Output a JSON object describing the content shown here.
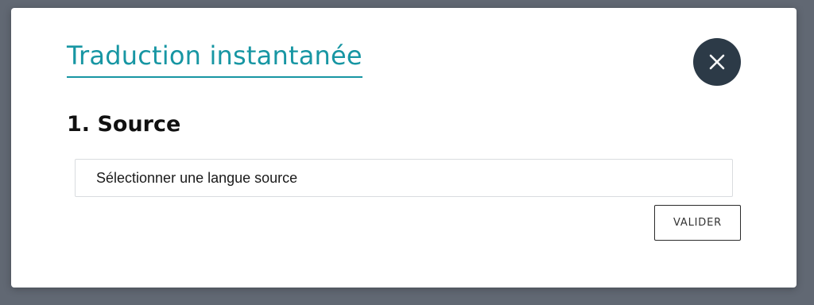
{
  "modal": {
    "title": "Traduction instantanée",
    "close_icon": "close-icon",
    "section_heading": "1. Source",
    "source_select": {
      "placeholder": "Sélectionner une langue source"
    },
    "validate_label": "VALIDER"
  },
  "colors": {
    "backdrop": "#616873",
    "accent": "#1796a3",
    "close_button_bg": "#2c3a47"
  }
}
